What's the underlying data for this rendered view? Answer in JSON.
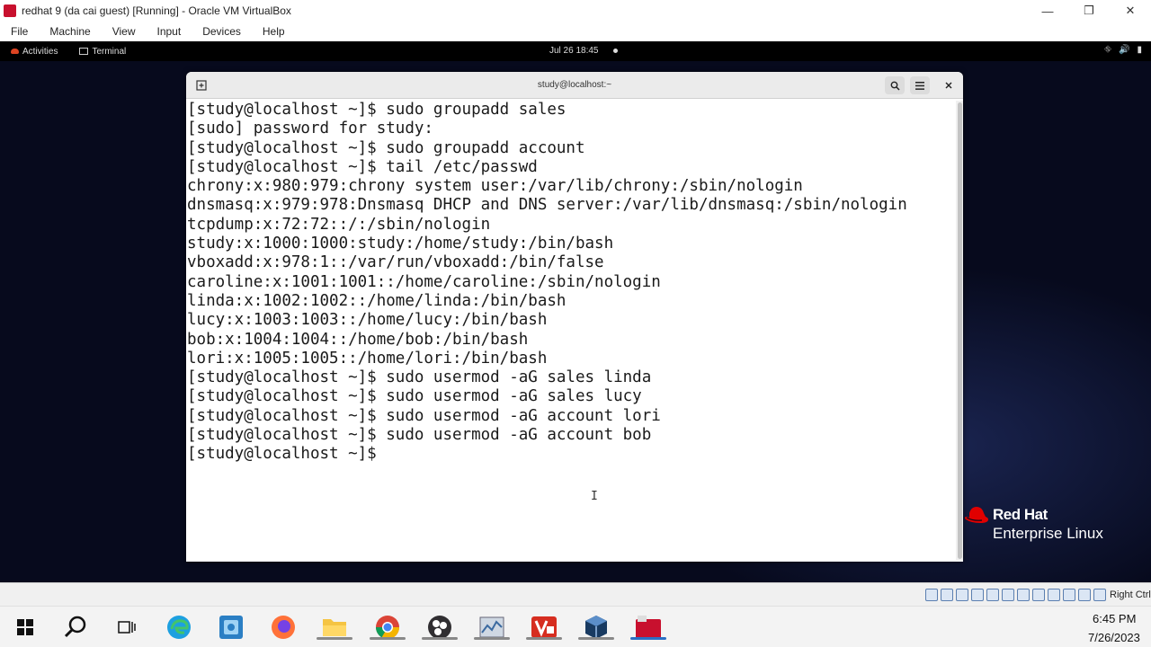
{
  "host_window": {
    "title": "redhat 9 (da cai guest) [Running] - Oracle VM VirtualBox",
    "controls": {
      "minimize": "—",
      "restore": "❐",
      "close": "✕"
    },
    "menu": [
      "File",
      "Machine",
      "View",
      "Input",
      "Devices",
      "Help"
    ]
  },
  "gnome_panel": {
    "activities": "Activities",
    "app_name": "Terminal",
    "clock": "Jul 26  18:45",
    "tray": {
      "network": "⛗",
      "volume": "🔊",
      "battery": "▮"
    }
  },
  "terminal": {
    "title": "study@localhost:~",
    "lines": [
      "[study@localhost ~]$ sudo groupadd sales",
      "[sudo] password for study:",
      "[study@localhost ~]$ sudo groupadd account",
      "[study@localhost ~]$ tail /etc/passwd",
      "chrony:x:980:979:chrony system user:/var/lib/chrony:/sbin/nologin",
      "dnsmasq:x:979:978:Dnsmasq DHCP and DNS server:/var/lib/dnsmasq:/sbin/nologin",
      "tcpdump:x:72:72::/:/sbin/nologin",
      "study:x:1000:1000:study:/home/study:/bin/bash",
      "vboxadd:x:978:1::/var/run/vboxadd:/bin/false",
      "caroline:x:1001:1001::/home/caroline:/sbin/nologin",
      "linda:x:1002:1002::/home/linda:/bin/bash",
      "lucy:x:1003:1003::/home/lucy:/bin/bash",
      "bob:x:1004:1004::/home/bob:/bin/bash",
      "lori:x:1005:1005::/home/lori:/bin/bash",
      "[study@localhost ~]$ sudo usermod -aG sales linda",
      "[study@localhost ~]$ sudo usermod -aG sales lucy",
      "[study@localhost ~]$ sudo usermod -aG account lori",
      "[study@localhost ~]$ sudo usermod -aG account bob",
      "[study@localhost ~]$"
    ]
  },
  "desktop_logo": {
    "line1": "Red Hat",
    "line2": "Enterprise Linux"
  },
  "vb_status": {
    "host_key": "Right Ctrl"
  },
  "taskbar": {
    "time": "6:45 PM",
    "date": "7/26/2023",
    "apps": [
      "start",
      "search",
      "task-view",
      "edge",
      "app",
      "firefox",
      "file-explorer",
      "chrome",
      "obs",
      "app",
      "app",
      "virtualbox",
      "redhat-vm"
    ]
  },
  "colors": {
    "guest_background": "#070a1d",
    "terminal_text": "#1a1a1a",
    "redhat_red": "#e00000"
  }
}
